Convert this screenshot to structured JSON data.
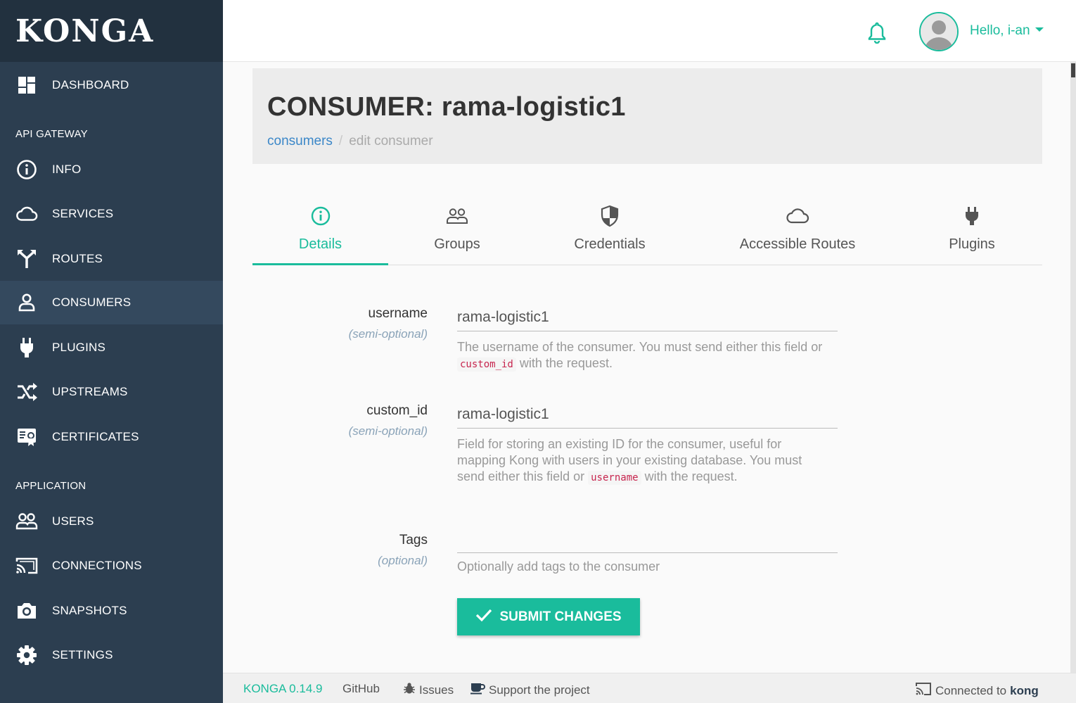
{
  "app": {
    "logo": "KONGA"
  },
  "sidebar": {
    "dashboard": "DASHBOARD",
    "section_api": "API GATEWAY",
    "info": "INFO",
    "services": "SERVICES",
    "routes": "ROUTES",
    "consumers": "CONSUMERS",
    "plugins": "PLUGINS",
    "upstreams": "UPSTREAMS",
    "certificates": "CERTIFICATES",
    "section_app": "APPLICATION",
    "users": "USERS",
    "connections": "CONNECTIONS",
    "snapshots": "SNAPSHOTS",
    "settings": "SETTINGS",
    "active": "consumers"
  },
  "header": {
    "greeting": "Hello, i-an"
  },
  "page": {
    "title": "CONSUMER: rama-logistic1",
    "breadcrumb_link": "consumers",
    "breadcrumb_sep": "/",
    "breadcrumb_current": "edit consumer"
  },
  "tabs": {
    "details": "Details",
    "groups": "Groups",
    "credentials": "Credentials",
    "accessible_routes": "Accessible Routes",
    "plugins": "Plugins",
    "active": "details"
  },
  "form": {
    "username": {
      "label": "username",
      "sub": "(semi-optional)",
      "value": "rama-logistic1",
      "help_pre": "The username of the consumer. You must send either this field or",
      "help_code": "custom_id",
      "help_post": "with the request."
    },
    "custom_id": {
      "label": "custom_id",
      "sub": "(semi-optional)",
      "value": "rama-logistic1",
      "help_pre": "Field for storing an existing ID for the consumer, useful for mapping Kong with users in your existing database. You must send either this field or",
      "help_code": "username",
      "help_post": "with the request."
    },
    "tags": {
      "label": "Tags",
      "sub": "(optional)",
      "value": "",
      "help": "Optionally add tags to the consumer"
    },
    "submit_label": "SUBMIT CHANGES"
  },
  "footer": {
    "version": "KONGA 0.14.9",
    "github": "GitHub",
    "issues": "Issues",
    "support": "Support the project",
    "connected_prefix": "Connected to",
    "connected_target": "kong"
  },
  "colors": {
    "accent": "#1abc9c",
    "sidebar_bg": "#2c3e50",
    "sidebar_active": "#34495e",
    "link": "#3b87c8"
  },
  "icons": {
    "dashboard": "dashboard-icon",
    "info": "info-icon",
    "services": "cloud-icon",
    "routes": "routes-icon",
    "consumers": "user-icon",
    "plugins": "plug-icon",
    "upstreams": "shuffle-icon",
    "certificates": "certificate-icon",
    "users": "users-icon",
    "connections": "cast-icon",
    "snapshots": "camera-icon",
    "settings": "gear-icon"
  }
}
